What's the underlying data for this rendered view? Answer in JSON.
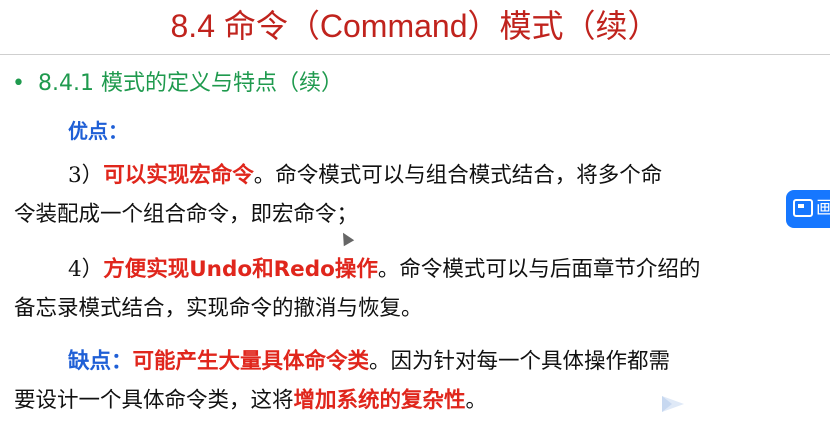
{
  "title": "8.4  命令（Command）模式（续）",
  "bullet": {
    "symbol": "•",
    "text": "8.4.1 模式的定义与特点（续）"
  },
  "advantages_label": "优点：",
  "para1": {
    "num": "3）",
    "highlight": "可以实现宏命令",
    "rest_line1": "。命令模式可以与组合模式结合，将多个命",
    "line2": "令装配成一个组合命令，即宏命令；"
  },
  "para2": {
    "num": "4）",
    "highlight": "方便实现Undo和Redo操作",
    "rest_line1": "。命令模式可以与后面章节介绍的",
    "line2": "备忘录模式结合，实现命令的撤消与恢复。"
  },
  "para3": {
    "label": "缺点：",
    "highlight": "可能产生大量具体命令类",
    "rest_line1": "。因为针对每一个具体操作都需",
    "line2_pre": "要设计一个具体命令类，这将",
    "line2_highlight": "增加系统的复杂性",
    "line2_post": "。"
  },
  "side_tool": {
    "text": "画",
    "icon": "screenshot-icon",
    "color": "#1677ff"
  },
  "colors": {
    "title": "#c0231d",
    "bullet": "#1f9a4e",
    "blue": "#1f5fd6",
    "red": "#e0261c"
  }
}
